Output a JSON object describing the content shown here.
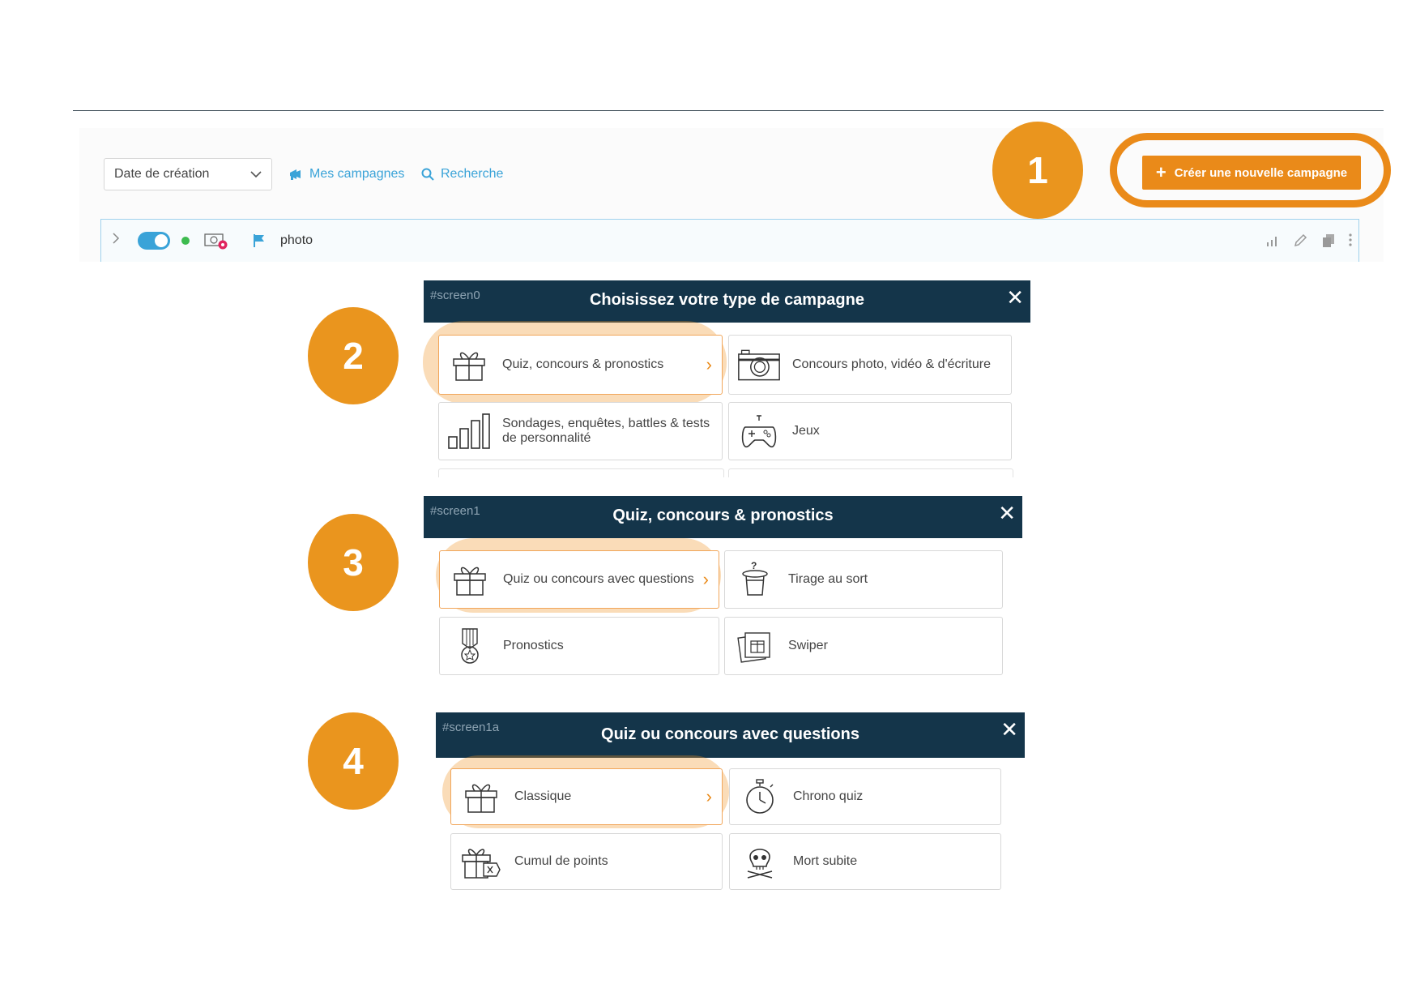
{
  "toolbar": {
    "sort_select": "Date de création",
    "my_campaigns": "Mes campagnes",
    "search": "Recherche",
    "create_button": "Créer une nouvelle campagne"
  },
  "campaign_row": {
    "name": "photo"
  },
  "steps": [
    "1",
    "2",
    "3",
    "4"
  ],
  "screens": [
    {
      "id": "#screen0",
      "title": "Choisissez votre type de campagne",
      "options": [
        {
          "label": "Quiz, concours & pronostics",
          "icon": "gift-icon",
          "selected": true
        },
        {
          "label": "Concours photo, vidéo & d'écriture",
          "icon": "camera-icon"
        },
        {
          "label": "Sondages, enquêtes, battles & tests de personnalité",
          "icon": "bar-chart-icon"
        },
        {
          "label": "Jeux",
          "icon": "gamepad-icon"
        }
      ]
    },
    {
      "id": "#screen1",
      "title": "Quiz, concours & pronostics",
      "options": [
        {
          "label": "Quiz ou concours avec questions",
          "icon": "gift-icon",
          "selected": true
        },
        {
          "label": "Tirage au sort",
          "icon": "magic-hat-icon"
        },
        {
          "label": "Pronostics",
          "icon": "medal-icon"
        },
        {
          "label": "Swiper",
          "icon": "swipe-cards-icon"
        }
      ]
    },
    {
      "id": "#screen1a",
      "title": "Quiz ou concours avec questions",
      "options": [
        {
          "label": "Classique",
          "icon": "gift-icon",
          "selected": true
        },
        {
          "label": "Chrono quiz",
          "icon": "stopwatch-icon"
        },
        {
          "label": "Cumul de points",
          "icon": "gift-tag-icon"
        },
        {
          "label": "Mort subite",
          "icon": "skull-icon"
        }
      ]
    }
  ],
  "colors": {
    "accent": "#ea8a19",
    "header": "#14354a",
    "link": "#3aa3d8",
    "step": "#ea951e"
  }
}
